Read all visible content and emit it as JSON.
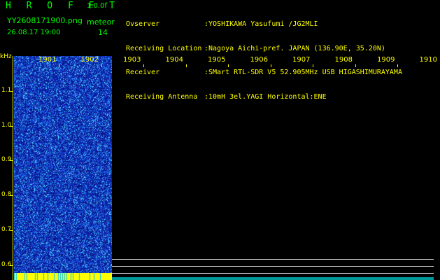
{
  "header": {
    "title": "H R O F F T",
    "version": "1.0.0f",
    "filename": "YY2608171900.png",
    "timestamp": "26.08.17 19:00",
    "mode": "meteor",
    "count": "14"
  },
  "info": [
    {
      "key": "Ovserver",
      "value": ":YOSHIKAWA Yasufumi /JG2MLI"
    },
    {
      "key": "Receiving Location",
      "value": ":Nagoya Aichi-pref. JAPAN (136.90E, 35.20N)"
    },
    {
      "key": "Receiver",
      "value": ":SMart RTL-SDR V5 52.905MHz USB HIGASHIMURAYAMA"
    },
    {
      "key": "Receiving Antenna",
      "value": ":10mH 3el.YAGI Horizontal:ENE"
    }
  ],
  "chart": {
    "ylabel": "kHz",
    "yticks": [
      "1.1",
      "1.0",
      "0.9",
      "0.8",
      "0.7",
      "0.6"
    ],
    "xticks": [
      "1901",
      "1902",
      "1903",
      "1904",
      "1905",
      "1906",
      "1907",
      "1908",
      "1909",
      "1910"
    ]
  },
  "colors": {
    "background": "#000000",
    "text": "#ffff00",
    "title": "#00ff00",
    "spectro_low": "#0a1a8a",
    "spectro_high": "#40e0ff"
  }
}
